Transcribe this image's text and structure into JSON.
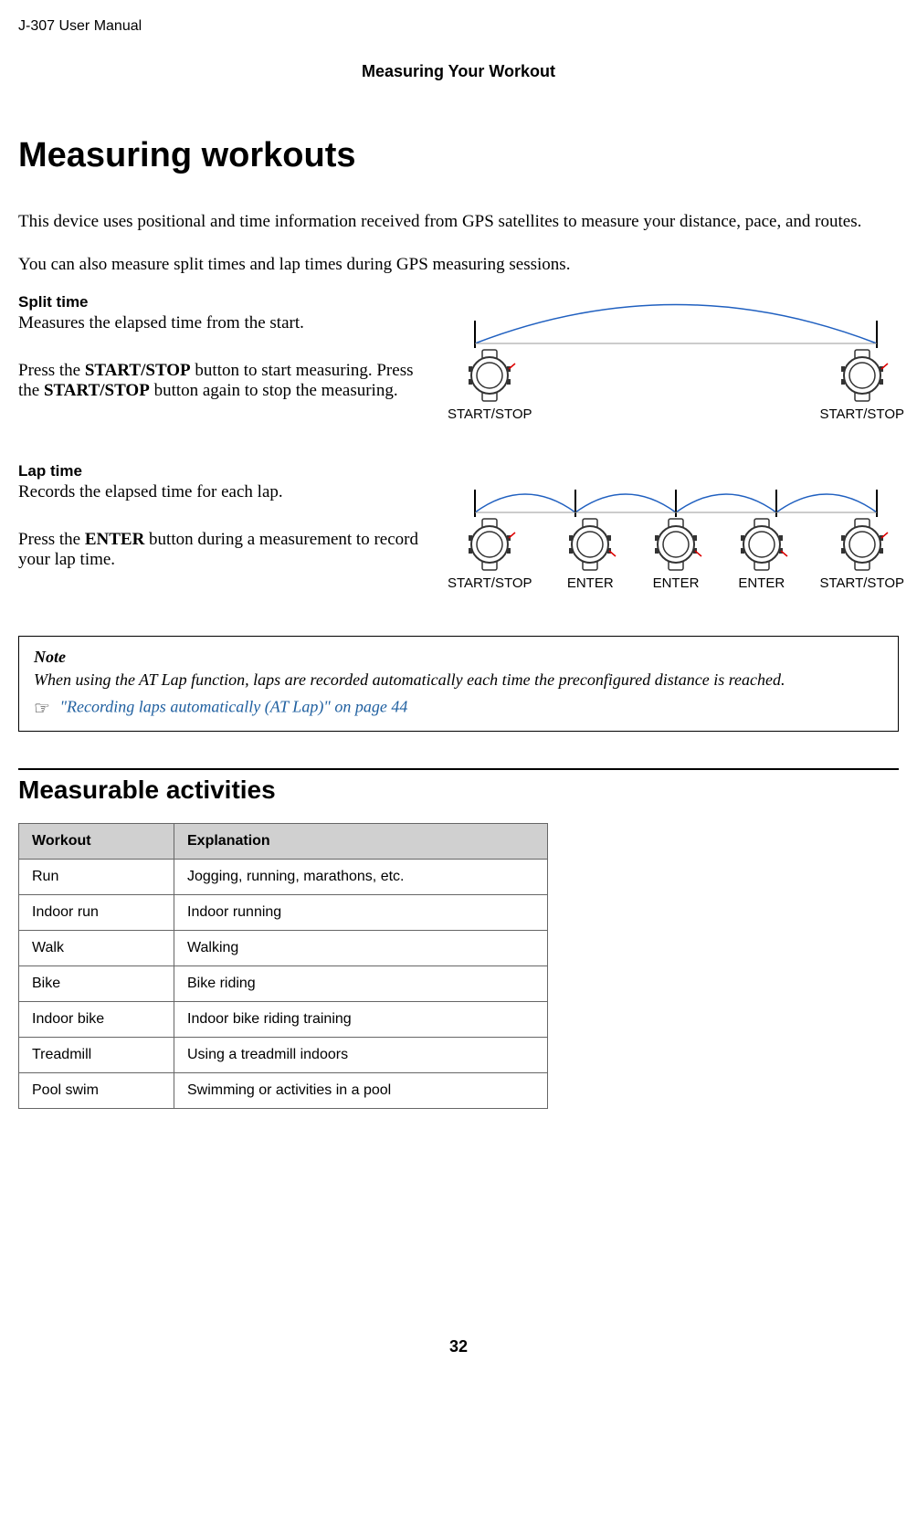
{
  "headerLeft": "J-307     User Manual",
  "sectionHeader": "Measuring Your Workout",
  "pageTitle": "Measuring workouts",
  "introText": "This device uses positional and time information received from GPS satellites to measure your distance, pace, and routes.",
  "subIntro": "You can also measure split times and lap times during GPS measuring sessions.",
  "split": {
    "heading": "Split time",
    "desc": "Measures the elapsed time from the start.",
    "instrPre": "Press the ",
    "btn1": "START/STOP",
    "instrMid": " button to start measuring. Press the ",
    "btn2": "START/STOP",
    "instrPost": " button again to stop the measuring.",
    "labelLeft": "START/STOP",
    "labelRight": "START/STOP"
  },
  "lap": {
    "heading": "Lap time",
    "desc": "Records the elapsed time for each lap.",
    "instrPre": "Press the ",
    "btn": "ENTER",
    "instrPost": " button during a measurement to record your lap time.",
    "labels": [
      "START/STOP",
      "ENTER",
      "ENTER",
      "ENTER",
      "START/STOP"
    ]
  },
  "note": {
    "label": "Note",
    "text": "When using the AT Lap function, laps are recorded automatically each time the preconfigured distance is reached.",
    "link": "\"Recording laps automatically (AT Lap)\" on page 44"
  },
  "measurable": {
    "heading": "Measurable activities",
    "col1": "Workout",
    "col2": "Explanation",
    "rows": [
      {
        "w": "Run",
        "e": "Jogging, running, marathons, etc."
      },
      {
        "w": "Indoor run",
        "e": "Indoor running"
      },
      {
        "w": "Walk",
        "e": "Walking"
      },
      {
        "w": "Bike",
        "e": "Bike riding"
      },
      {
        "w": "Indoor bike",
        "e": "Indoor bike riding training"
      },
      {
        "w": "Treadmill",
        "e": "Using a treadmill indoors"
      },
      {
        "w": "Pool swim",
        "e": "Swimming or activities in a pool"
      }
    ]
  },
  "pageNumber": "32"
}
